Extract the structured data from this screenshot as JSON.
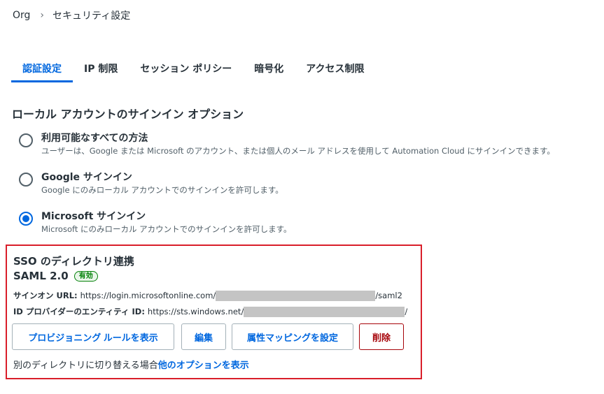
{
  "breadcrumb": {
    "root": "Org",
    "separator": "›",
    "current": "セキュリティ設定"
  },
  "tabs": [
    {
      "label": "認証設定",
      "active": true
    },
    {
      "label": "IP 制限",
      "active": false
    },
    {
      "label": "セッション ポリシー",
      "active": false
    },
    {
      "label": "暗号化",
      "active": false
    },
    {
      "label": "アクセス制限",
      "active": false
    }
  ],
  "local_signin": {
    "title": "ローカル アカウントのサインイン オプション",
    "options": [
      {
        "label": "利用可能なすべての方法",
        "description": "ユーザーは、Google または Microsoft のアカウント、または個人のメール アドレスを使用して Automation Cloud にサインインできます。",
        "selected": false
      },
      {
        "label": "Google サインイン",
        "description": "Google にのみローカル アカウントでのサインインを許可します。",
        "selected": false
      },
      {
        "label": "Microsoft サインイン",
        "description": "Microsoft にのみローカル アカウントでのサインインを許可します。",
        "selected": true
      }
    ]
  },
  "sso": {
    "title": "SSO のディレクトリ連携",
    "protocol": "SAML 2.0",
    "status_badge": "有効",
    "signon_url_label": "サインオン URL:",
    "signon_url_prefix": "https://login.microsoftonline.com/",
    "signon_url_suffix": "/saml2",
    "entity_id_label": "ID プロバイダーのエンティティ ID:",
    "entity_id_prefix": "https://sts.windows.net/",
    "entity_id_suffix": "/",
    "buttons": {
      "provisioning": "プロビジョニング ルールを表示",
      "edit": "編集",
      "attribute_mapping": "属性マッピングを設定",
      "delete": "削除"
    },
    "footer_text": "別のディレクトリに切り替える場合",
    "footer_link": "他のオプションを表示"
  },
  "colors": {
    "accent": "#0067df",
    "danger": "#a6040a",
    "highlight_border": "#d91e2a",
    "success": "#038108"
  }
}
